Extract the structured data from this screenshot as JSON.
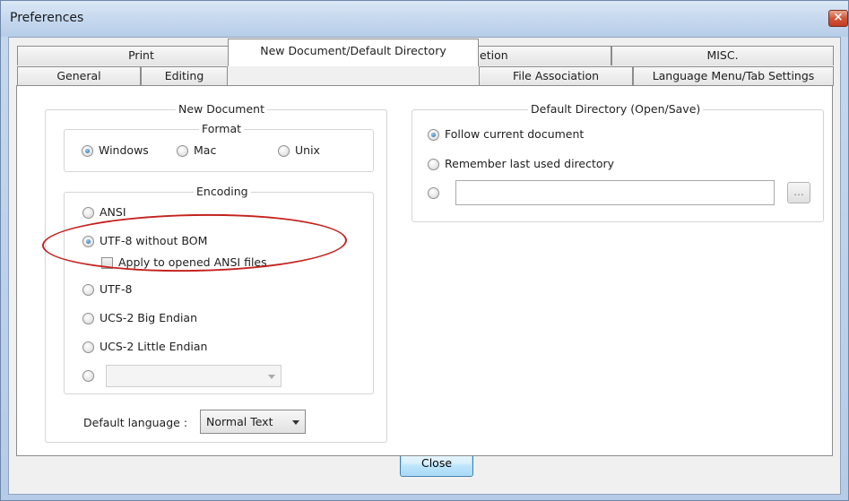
{
  "window": {
    "title": "Preferences",
    "close_glyph": "×"
  },
  "tabs": {
    "row1": [
      {
        "label": "Print"
      },
      {
        "label": "Backup/Auto-Completion"
      },
      {
        "label": "MISC."
      }
    ],
    "row2": [
      {
        "label": "General"
      },
      {
        "label": "Editing"
      },
      {
        "label": "New Document/Default Directory",
        "active": true
      },
      {
        "label": "File Association"
      },
      {
        "label": "Language Menu/Tab Settings"
      }
    ]
  },
  "new_document": {
    "legend": "New Document",
    "format": {
      "legend": "Format",
      "options": [
        "Windows",
        "Mac",
        "Unix"
      ],
      "selected": "Windows"
    },
    "encoding": {
      "legend": "Encoding",
      "options": [
        "ANSI",
        "UTF-8 without BOM",
        "UTF-8",
        "UCS-2 Big Endian",
        "UCS-2 Little Endian"
      ],
      "selected": "UTF-8 without BOM",
      "apply_ansi_label": "Apply to opened ANSI files",
      "apply_ansi_checked": false,
      "other_combo_value": ""
    },
    "default_language": {
      "label": "Default language :",
      "value": "Normal Text"
    }
  },
  "default_directory": {
    "legend": "Default Directory (Open/Save)",
    "options": [
      "Follow current document",
      "Remember last used directory"
    ],
    "selected": "Follow current document",
    "custom_path_value": "",
    "browse_label": "..."
  },
  "footer": {
    "close_label": "Close"
  },
  "annotation": {
    "oval_color": "#c4221e"
  },
  "colors": {
    "titlebar": "#c4d7ee",
    "dialog_bg": "#f0f0f0",
    "radio_dot": "#1c5e9c",
    "close_button_border": "#3c7fb1"
  }
}
